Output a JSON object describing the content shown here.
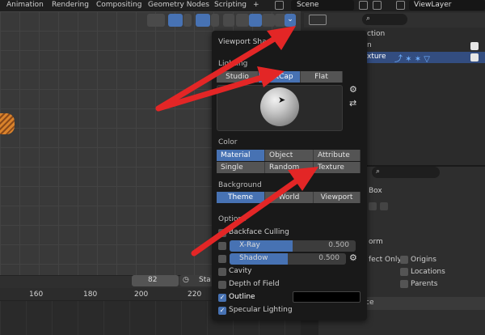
{
  "topbar": {
    "tabs": [
      "Animation",
      "Rendering",
      "Compositing",
      "Geometry Nodes",
      "Scripting"
    ],
    "add_tab": "+",
    "scene": "Scene",
    "view_layer": "ViewLayer"
  },
  "viewport": {
    "shading_dropdown": "⌄"
  },
  "timeline": {
    "frame": "82",
    "start_label": "Sta",
    "ticks": [
      "160",
      "180",
      "200",
      "220"
    ]
  },
  "outliner": {
    "rows": [
      "ction",
      "n",
      "xture"
    ]
  },
  "properties": {
    "box_label": "Box",
    "orm_label": "orm",
    "affect_only_label": "fect Only",
    "origins": "Origins",
    "locations": "Locations",
    "parents": "Parents",
    "section_label": "ce"
  },
  "popover": {
    "title": "Viewport Sha",
    "lighting": {
      "label": "Lighting",
      "options": [
        "Studio",
        "MatCap",
        "Flat"
      ],
      "selected": "MatCap"
    },
    "color": {
      "label": "Color",
      "options": [
        "Material",
        "Object",
        "Attribute",
        "Single",
        "Random",
        "Texture"
      ],
      "selected": "Material"
    },
    "background": {
      "label": "Background",
      "options": [
        "Theme",
        "World",
        "Viewport"
      ],
      "selected": "Theme"
    },
    "options": {
      "label": "Options",
      "backface_culling": "Backface Culling",
      "xray": {
        "name": "X-Ray",
        "value": "0.500",
        "fraction": 0.5
      },
      "shadow": {
        "name": "Shadow",
        "value": "0.500",
        "fraction": 0.5
      },
      "cavity": "Cavity",
      "depth_of_field": "Depth of Field",
      "outline": "Outline",
      "specular_lighting": "Specular Lighting"
    }
  },
  "colors": {
    "accent": "#4772b3",
    "arrow": "#e32626",
    "popover_bg": "#191919"
  }
}
